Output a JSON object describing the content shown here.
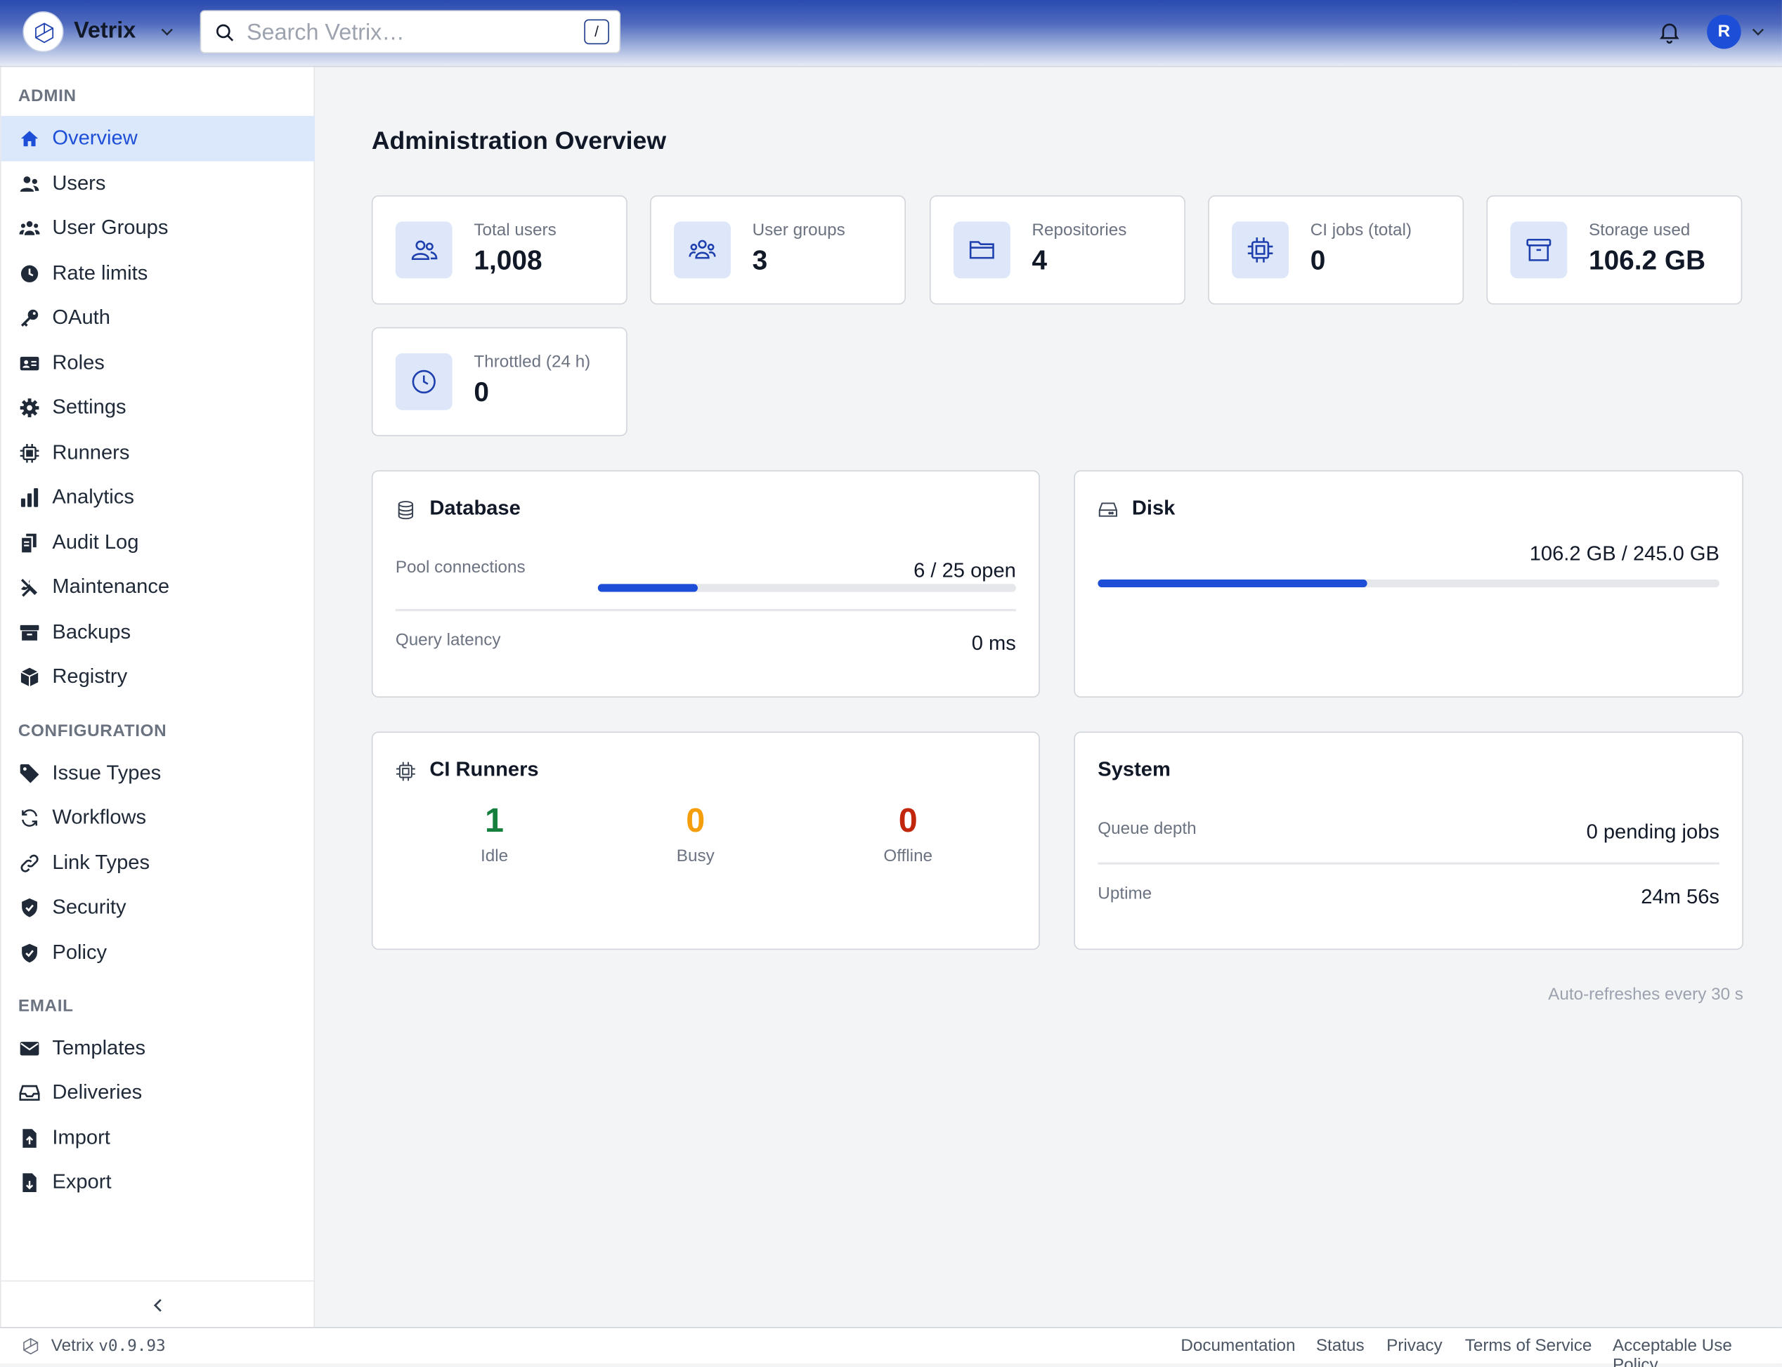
{
  "header": {
    "brand": "Vetrix",
    "search_placeholder": "Search Vetrix…",
    "search_shortcut": "/",
    "avatar_initial": "R"
  },
  "sidebar": {
    "sections": [
      "ADMIN",
      "CONFIGURATION",
      "EMAIL"
    ],
    "items": [
      {
        "label": "Overview",
        "icon": "home-icon",
        "active": true
      },
      {
        "label": "Users",
        "icon": "users-icon"
      },
      {
        "label": "User Groups",
        "icon": "user-groups-icon"
      },
      {
        "label": "Rate limits",
        "icon": "clock-icon"
      },
      {
        "label": "OAuth",
        "icon": "key-icon"
      },
      {
        "label": "Roles",
        "icon": "id-card-icon"
      },
      {
        "label": "Settings",
        "icon": "gear-icon"
      },
      {
        "label": "Runners",
        "icon": "chip-icon"
      },
      {
        "label": "Analytics",
        "icon": "bar-chart-icon"
      },
      {
        "label": "Audit Log",
        "icon": "audit-log-icon"
      },
      {
        "label": "Maintenance",
        "icon": "tools-icon"
      },
      {
        "label": "Backups",
        "icon": "archive-icon"
      },
      {
        "label": "Registry",
        "icon": "box-icon"
      },
      {
        "label": "Issue Types",
        "icon": "tag-icon"
      },
      {
        "label": "Workflows",
        "icon": "refresh-icon"
      },
      {
        "label": "Link Types",
        "icon": "link-icon"
      },
      {
        "label": "Security",
        "icon": "shield-icon"
      },
      {
        "label": "Policy",
        "icon": "shield-check-icon"
      },
      {
        "label": "Templates",
        "icon": "envelope-icon"
      },
      {
        "label": "Deliveries",
        "icon": "inbox-icon"
      },
      {
        "label": "Import",
        "icon": "file-import-icon"
      },
      {
        "label": "Export",
        "icon": "file-export-icon"
      }
    ]
  },
  "main": {
    "title": "Administration Overview",
    "stats": [
      {
        "label": "Total users",
        "value": "1,008",
        "icon": "users-outline-icon"
      },
      {
        "label": "User groups",
        "value": "3",
        "icon": "user-group-outline-icon"
      },
      {
        "label": "Repositories",
        "value": "4",
        "icon": "folder-icon"
      },
      {
        "label": "CI jobs (total)",
        "value": "0",
        "icon": "chip-outline-icon"
      },
      {
        "label": "Storage used",
        "value": "106.2 GB",
        "icon": "archive-outline-icon"
      },
      {
        "label": "Throttled (24 h)",
        "value": "0",
        "icon": "clock-outline-icon"
      }
    ],
    "database": {
      "title": "Database",
      "pool_label": "Pool connections",
      "pool_value": "6 / 25 open",
      "pool_fraction": 0.24,
      "latency_label": "Query latency",
      "latency_value": "0 ms"
    },
    "disk": {
      "title": "Disk",
      "usage": "106.2 GB / 245.0 GB",
      "fraction": 0.4335
    },
    "ci_runners": {
      "title": "CI Runners",
      "stats": [
        {
          "value": "1",
          "label": "Idle",
          "color": "#15803d"
        },
        {
          "value": "0",
          "label": "Busy",
          "color": "#f59e0b"
        },
        {
          "value": "0",
          "label": "Offline",
          "color": "#c2260c"
        }
      ]
    },
    "system": {
      "title": "System",
      "queue_label": "Queue depth",
      "queue_value": "0 pending jobs",
      "uptime_label": "Uptime",
      "uptime_value": "24m 56s"
    },
    "auto_refresh": "Auto-refreshes every 30 s"
  },
  "footer": {
    "name": "Vetrix",
    "version": "v0.9.93",
    "links": [
      "Documentation",
      "Status",
      "Privacy",
      "Terms of Service",
      "Acceptable Use Policy"
    ]
  },
  "colors": {
    "accent": "#1d4ed8",
    "active_nav_bg": "#dbe7fb",
    "stat_icon_bg": "#dde7f9"
  }
}
